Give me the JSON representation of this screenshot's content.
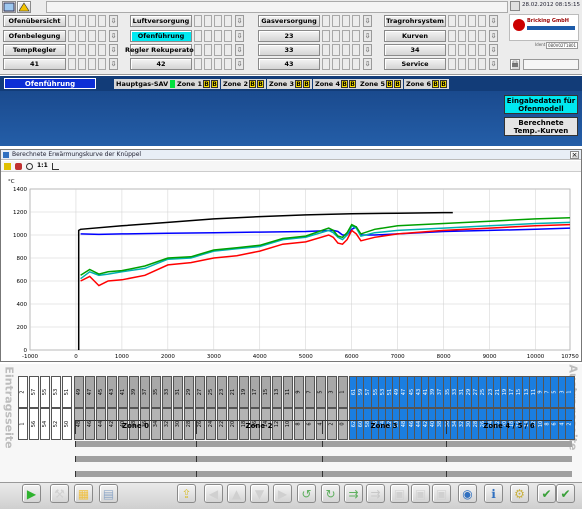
{
  "header": {
    "date_time": "28.02.2012 08:15:15",
    "company": "Bricking GmbH",
    "device_id": "080V02T1801"
  },
  "nav": {
    "row1": [
      "Ofenübersicht",
      "Luftversorgung",
      "Gasversorgung",
      "Tragrohrsystem"
    ],
    "row2": [
      "Ofenbelegung",
      "Ofenführung",
      "23",
      "Kurven"
    ],
    "row3": [
      "TempRegler",
      "Regler Rekuperator",
      "33",
      "34"
    ],
    "row4": [
      "41",
      "42",
      "43",
      "Service"
    ]
  },
  "statusbar": {
    "title": "Ofenführung",
    "hauptgas": "Hauptgas-SAV",
    "zones": [
      "Zone 1",
      "Zone 2",
      "Zone 3",
      "Zone 4",
      "Zone 5",
      "Zone 6"
    ],
    "b_label": "B"
  },
  "right_buttons": {
    "eingabe": "Eingabedaten für Ofenmodell",
    "berechnete": "Berechnete Temp.-Kurven"
  },
  "chart_window": {
    "title": "Berechnete Erwärmungskurve der Knüppel",
    "close": "×",
    "toolbar_text": "1:1"
  },
  "chart_data": {
    "type": "line",
    "ylabel": "°C",
    "ylim": [
      0,
      1400
    ],
    "xlim": [
      -1000,
      10750
    ],
    "x_ticks": [
      -1000,
      0,
      1000,
      2000,
      3000,
      4000,
      5000,
      6000,
      7000,
      8000,
      9000,
      10000,
      10750
    ],
    "y_ticks": [
      0,
      200,
      400,
      600,
      800,
      1000,
      1200,
      1400
    ],
    "series": [
      {
        "color": "#000000",
        "x": [
          60,
          60,
          100,
          1000,
          2000,
          3000,
          4000,
          5000,
          6000,
          7000,
          8000,
          8200
        ],
        "y": [
          0,
          1040,
          1050,
          1080,
          1110,
          1140,
          1160,
          1175,
          1185,
          1190,
          1195,
          1195
        ]
      },
      {
        "color": "#0000ff",
        "x": [
          100,
          500,
          1000,
          2000,
          3000,
          4000,
          5000,
          5600,
          5700,
          5800,
          5900,
          6000,
          6100,
          6200,
          6500,
          7000,
          8000,
          9000,
          10000,
          10750
        ],
        "y": [
          1010,
          1005,
          1010,
          1015,
          1020,
          1025,
          1030,
          1040,
          1030,
          1000,
          1000,
          1050,
          1070,
          1000,
          1000,
          1010,
          1030,
          1040,
          1050,
          1060
        ]
      },
      {
        "color": "#00b0b0",
        "x": [
          100,
          300,
          500,
          700,
          1000,
          1500,
          2000,
          2500,
          3000,
          3500,
          4000,
          4500,
          5000,
          5500,
          5600,
          5700,
          5800,
          5900,
          6000,
          6100,
          6200,
          6500,
          7000,
          8000,
          9000,
          10000,
          10750
        ],
        "y": [
          620,
          680,
          650,
          660,
          680,
          710,
          790,
          800,
          860,
          880,
          900,
          960,
          980,
          1040,
          1020,
          980,
          960,
          1000,
          1080,
          1060,
          990,
          1020,
          1040,
          1060,
          1080,
          1100,
          1110
        ]
      },
      {
        "color": "#00a000",
        "x": [
          100,
          300,
          500,
          700,
          1000,
          1500,
          2000,
          2500,
          3000,
          3500,
          4000,
          4500,
          5000,
          5500,
          5600,
          5700,
          5800,
          5900,
          6000,
          6100,
          6200,
          6500,
          7000,
          8000,
          9000,
          10000,
          10750
        ],
        "y": [
          650,
          700,
          660,
          680,
          690,
          730,
          800,
          810,
          870,
          890,
          910,
          970,
          990,
          1060,
          1040,
          990,
          980,
          1020,
          1090,
          1070,
          1010,
          1050,
          1080,
          1100,
          1120,
          1140,
          1150
        ]
      },
      {
        "color": "#ff0000",
        "x": [
          100,
          300,
          500,
          700,
          1000,
          1500,
          2000,
          2500,
          3000,
          3500,
          4000,
          4500,
          5000,
          5500,
          5600,
          5700,
          5800,
          5900,
          6000,
          6100,
          6200,
          6500,
          7000,
          8000,
          9000,
          10000,
          10750
        ],
        "y": [
          600,
          640,
          560,
          600,
          610,
          650,
          740,
          760,
          800,
          820,
          860,
          920,
          940,
          1000,
          980,
          930,
          920,
          960,
          1040,
          1010,
          950,
          980,
          1010,
          1040,
          1060,
          1080,
          1090
        ]
      }
    ]
  },
  "furnace": {
    "left_label": "Eintragsseite",
    "right_label": "Austragsseite",
    "zone_labels": [
      "Zone 0",
      "Zone 2",
      "Zone 3",
      "Zone 4 / 5 / 6"
    ],
    "top_white": [
      "2",
      "57",
      "55",
      "53",
      "51"
    ],
    "bottom_white": [
      "1",
      "56",
      "54",
      "52",
      "50"
    ],
    "top_gray": [
      "49",
      "47",
      "45",
      "43",
      "41",
      "39",
      "37",
      "35",
      "33",
      "31",
      "29",
      "27",
      "25",
      "23",
      "21",
      "19",
      "17",
      "15",
      "13",
      "11",
      "9",
      "7",
      "5",
      "3",
      "1"
    ],
    "bottom_gray": [
      "48",
      "46",
      "44",
      "42",
      "40",
      "38",
      "36",
      "34",
      "32",
      "30",
      "28",
      "26",
      "24",
      "22",
      "20",
      "18",
      "16",
      "14",
      "12",
      "10",
      "8",
      "6",
      "4",
      "2",
      "0"
    ],
    "top_blue": [
      "61",
      "59",
      "57",
      "55",
      "53",
      "51",
      "49",
      "47",
      "45",
      "43",
      "41",
      "39",
      "37",
      "35",
      "33",
      "31",
      "29",
      "27",
      "25",
      "23",
      "21",
      "19",
      "17",
      "15",
      "13",
      "11",
      "9",
      "7",
      "5",
      "3",
      "1"
    ],
    "bottom_blue": [
      "62",
      "60",
      "58",
      "56",
      "54",
      "52",
      "50",
      "48",
      "46",
      "44",
      "42",
      "40",
      "38",
      "36",
      "34",
      "32",
      "30",
      "28",
      "26",
      "24",
      "22",
      "20",
      "18",
      "16",
      "14",
      "12",
      "10",
      "8",
      "6",
      "4",
      "2"
    ]
  }
}
